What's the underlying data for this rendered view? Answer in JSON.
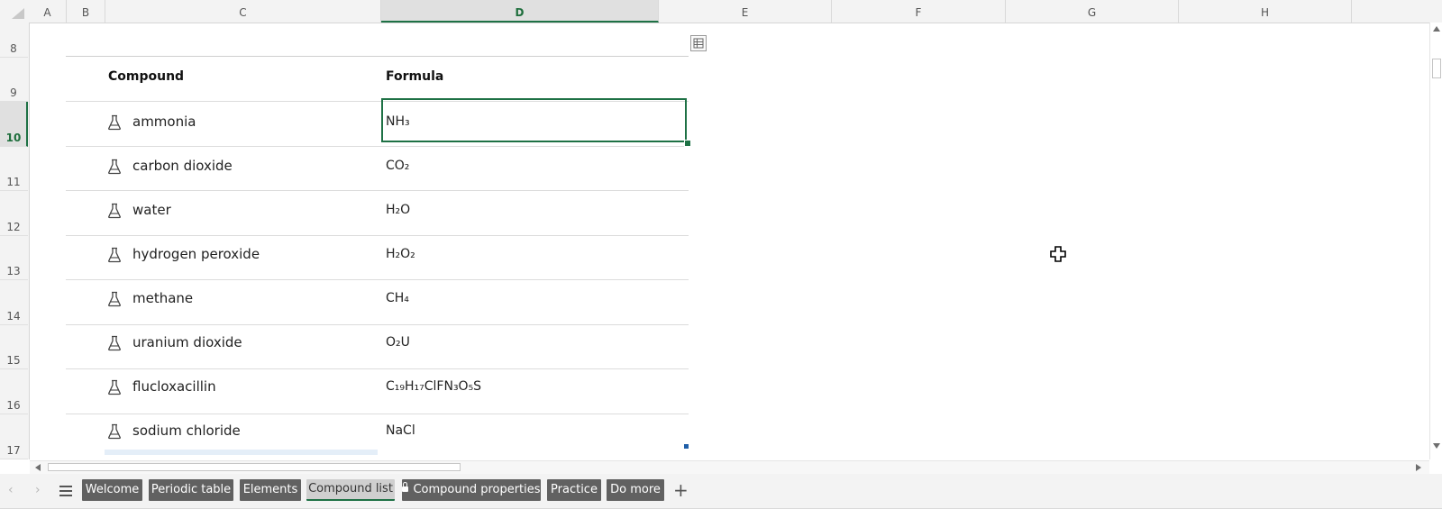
{
  "columns": [
    {
      "id": "col-a",
      "label": "A"
    },
    {
      "id": "col-b",
      "label": "B"
    },
    {
      "id": "col-c",
      "label": "C"
    },
    {
      "id": "col-d",
      "label": "D"
    },
    {
      "id": "col-e",
      "label": "E"
    },
    {
      "id": "col-f",
      "label": "F"
    },
    {
      "id": "col-g",
      "label": "G"
    },
    {
      "id": "col-h",
      "label": "H"
    }
  ],
  "active_column": "D",
  "rows": [
    "8",
    "9",
    "10",
    "11",
    "12",
    "13",
    "14",
    "15",
    "16",
    "17"
  ],
  "active_row": "10",
  "table": {
    "header_compound": "Compound",
    "header_formula": "Formula",
    "items": [
      {
        "compound": "ammonia",
        "formula": "NH₃"
      },
      {
        "compound": "carbon dioxide",
        "formula": "CO₂"
      },
      {
        "compound": "water",
        "formula": "H₂O"
      },
      {
        "compound": "hydrogen peroxide",
        "formula": "H₂O₂"
      },
      {
        "compound": "methane",
        "formula": "CH₄"
      },
      {
        "compound": "uranium dioxide",
        "formula": "O₂U"
      },
      {
        "compound": "flucloxacillin",
        "formula": "C₁₉H₁₇ClFN₃O₅S"
      },
      {
        "compound": "sodium chloride",
        "formula": "NaCl"
      }
    ],
    "row_icon": "flask-icon"
  },
  "sheet_tabs": [
    {
      "label": "Welcome"
    },
    {
      "label": "Periodic table"
    },
    {
      "label": "Elements"
    },
    {
      "label": "Compound list",
      "active": true
    },
    {
      "label": "Compound properties",
      "locked": true
    },
    {
      "label": "Practice"
    },
    {
      "label": "Do more"
    }
  ],
  "colors": {
    "accent": "#1e7145",
    "tab_bg": "#616161",
    "header_bg": "#f3f3f3"
  }
}
